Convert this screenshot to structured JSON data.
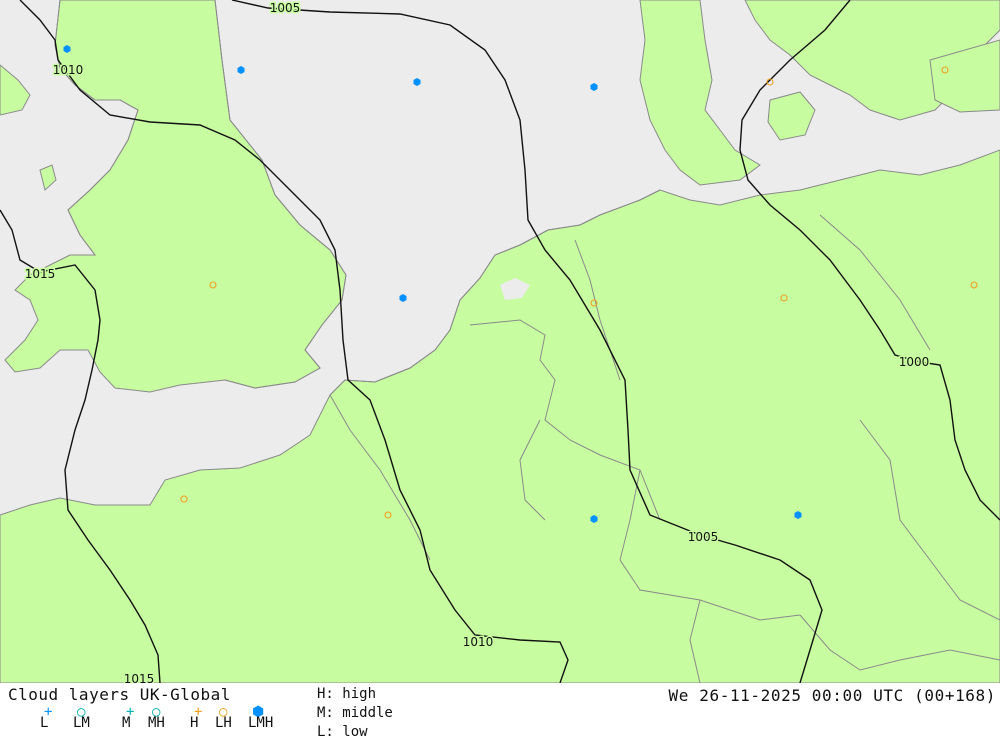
{
  "map": {
    "colors": {
      "sea": "#ececec",
      "land": "#c8fca0",
      "coast": "#8a8a8a",
      "isobar": "#111111",
      "cloud_blue": "#0090ff",
      "cloud_orange": "#f0a020",
      "cloud_cyan": "#00b0b0"
    },
    "isobars": [
      {
        "label": "1005"
      },
      {
        "label": "1010"
      },
      {
        "label": "1015"
      },
      {
        "label": "1015"
      },
      {
        "label": "1010"
      },
      {
        "label": "1005"
      },
      {
        "label": "1000"
      }
    ],
    "cloud_markers": [
      {
        "type": "LMH",
        "symbol": "filled-hexagon"
      },
      {
        "type": "LMH",
        "symbol": "filled-hexagon"
      },
      {
        "type": "LMH",
        "symbol": "filled-hexagon"
      },
      {
        "type": "LMH",
        "symbol": "filled-hexagon"
      },
      {
        "type": "LMH",
        "symbol": "filled-hexagon"
      },
      {
        "type": "LMH",
        "symbol": "filled-hexagon"
      },
      {
        "type": "LMH",
        "symbol": "filled-hexagon"
      },
      {
        "type": "LH",
        "symbol": "open-circle"
      },
      {
        "type": "LH",
        "symbol": "open-circle"
      },
      {
        "type": "LH",
        "symbol": "open-circle"
      },
      {
        "type": "LH",
        "symbol": "open-circle"
      },
      {
        "type": "LH",
        "symbol": "open-circle"
      },
      {
        "type": "LH",
        "symbol": "open-circle"
      },
      {
        "type": "LH",
        "symbol": "open-circle"
      },
      {
        "type": "LH",
        "symbol": "open-circle"
      }
    ]
  },
  "legend": {
    "title": "Cloud layers UK-Global",
    "codes": [
      {
        "code": "L",
        "symbol": "+",
        "color": "#0090ff"
      },
      {
        "code": "LM",
        "symbol": "○",
        "color": "#00b0b0"
      },
      {
        "code": "M",
        "symbol": "+",
        "color": "#00b0b0"
      },
      {
        "code": "MH",
        "symbol": "○",
        "color": "#00b0b0"
      },
      {
        "code": "H",
        "symbol": "+",
        "color": "#f0a020"
      },
      {
        "code": "LH",
        "symbol": "○",
        "color": "#f0a020"
      },
      {
        "code": "LMH",
        "symbol": "⬢",
        "color": "#0090ff"
      }
    ],
    "keys": {
      "high": "H: high",
      "middle": "M: middle",
      "low": "L: low"
    },
    "timestamp": "We 26-11-2025 00:00 UTC (00+168)"
  }
}
